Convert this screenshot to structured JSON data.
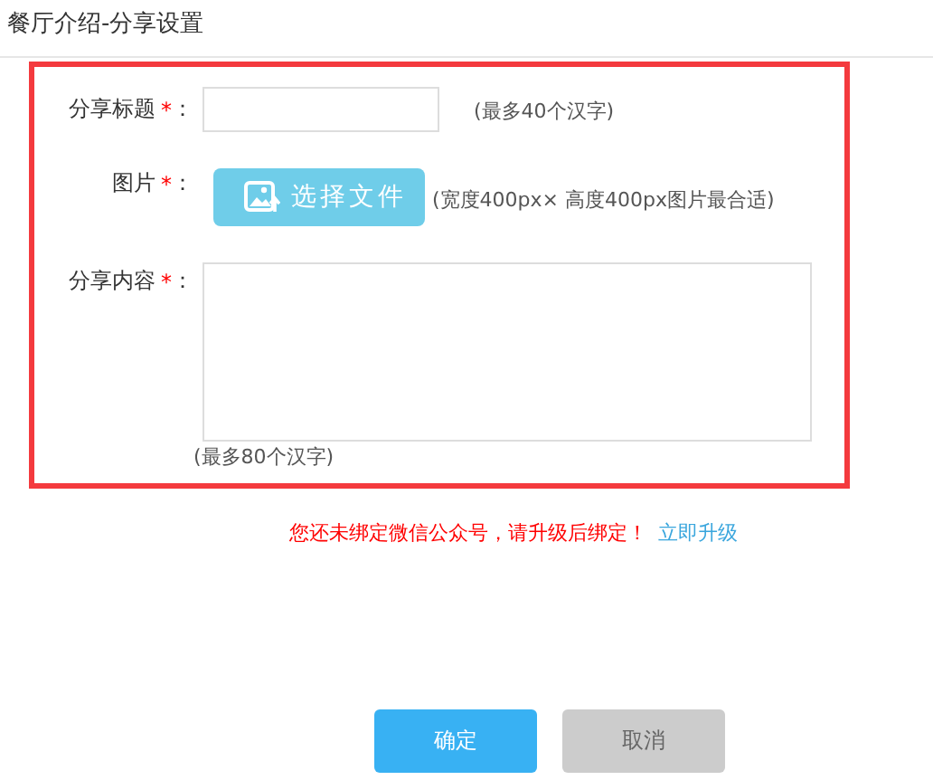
{
  "page_title": "餐厅介绍-分享设置",
  "fields": [
    {
      "kind": "text",
      "label": "分享标题",
      "required_mark": "*",
      "colon": "：",
      "hint": "(最多40个汉字)"
    },
    {
      "kind": "file",
      "label": "图片",
      "required_mark": "*",
      "colon": "：",
      "button": "选择文件",
      "hint": "(宽度400px× 高度400px图片最合适)"
    },
    {
      "kind": "textarea",
      "label": "分享内容",
      "required_mark": "*",
      "colon": "：",
      "hint": "(最多80个汉字)"
    }
  ],
  "warning": {
    "message": "您还未绑定微信公众号，请升级后绑定！",
    "link": "立即升级"
  },
  "buttons": [
    {
      "label": "确定",
      "kind": "primary"
    },
    {
      "label": "取消",
      "kind": "secondary"
    }
  ]
}
